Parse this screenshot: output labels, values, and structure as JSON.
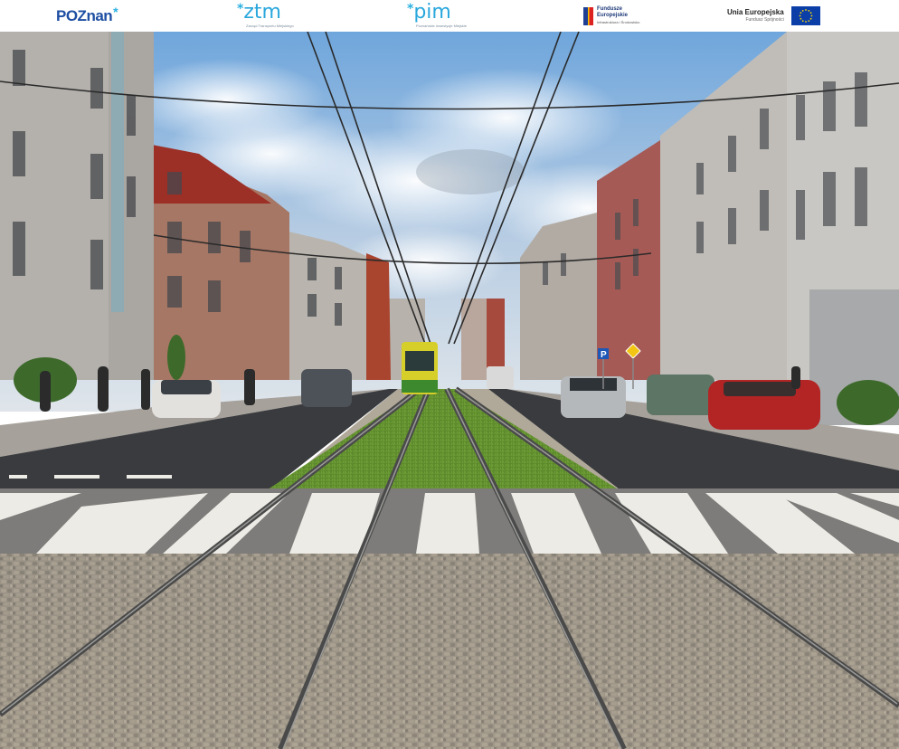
{
  "header": {
    "logos": {
      "poznan": "POZnan",
      "ztm": "ztm",
      "ztm_sub": "Zarząd Transportu Miejskiego",
      "pim": "pim",
      "pim_sub": "Poznańskie Inwestycje Miejskie",
      "fe_line1": "Fundusze",
      "fe_line2": "Europejskie",
      "fe_line3": "Infrastruktura i Środowisko",
      "ue_line1": "Unia Europejska",
      "ue_line2": "Fundusz Spójności"
    }
  },
  "colors": {
    "brand_blue": "#1e4fa3",
    "accent_cyan": "#2aa7dc",
    "eu_blue": "#0c3ea8",
    "eu_star": "#f7d800",
    "tram_yellow": "#d6cf2a",
    "tram_green": "#3d8a2e"
  },
  "scene": {
    "description_icons": [
      "parking-sign-icon",
      "warning-sign-icon",
      "street-lamp-icon"
    ],
    "signs": [
      "P"
    ]
  }
}
